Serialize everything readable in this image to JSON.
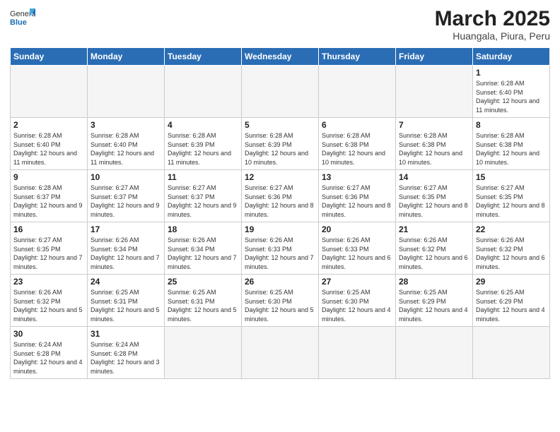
{
  "logo": {
    "text_general": "General",
    "text_blue": "Blue"
  },
  "title": "March 2025",
  "subtitle": "Huangala, Piura, Peru",
  "days_of_week": [
    "Sunday",
    "Monday",
    "Tuesday",
    "Wednesday",
    "Thursday",
    "Friday",
    "Saturday"
  ],
  "weeks": [
    [
      {
        "day": "",
        "info": ""
      },
      {
        "day": "",
        "info": ""
      },
      {
        "day": "",
        "info": ""
      },
      {
        "day": "",
        "info": ""
      },
      {
        "day": "",
        "info": ""
      },
      {
        "day": "",
        "info": ""
      },
      {
        "day": "1",
        "info": "Sunrise: 6:28 AM\nSunset: 6:40 PM\nDaylight: 12 hours and 11 minutes."
      }
    ],
    [
      {
        "day": "2",
        "info": "Sunrise: 6:28 AM\nSunset: 6:40 PM\nDaylight: 12 hours and 11 minutes."
      },
      {
        "day": "3",
        "info": "Sunrise: 6:28 AM\nSunset: 6:40 PM\nDaylight: 12 hours and 11 minutes."
      },
      {
        "day": "4",
        "info": "Sunrise: 6:28 AM\nSunset: 6:39 PM\nDaylight: 12 hours and 11 minutes."
      },
      {
        "day": "5",
        "info": "Sunrise: 6:28 AM\nSunset: 6:39 PM\nDaylight: 12 hours and 10 minutes."
      },
      {
        "day": "6",
        "info": "Sunrise: 6:28 AM\nSunset: 6:38 PM\nDaylight: 12 hours and 10 minutes."
      },
      {
        "day": "7",
        "info": "Sunrise: 6:28 AM\nSunset: 6:38 PM\nDaylight: 12 hours and 10 minutes."
      },
      {
        "day": "8",
        "info": "Sunrise: 6:28 AM\nSunset: 6:38 PM\nDaylight: 12 hours and 10 minutes."
      }
    ],
    [
      {
        "day": "9",
        "info": "Sunrise: 6:28 AM\nSunset: 6:37 PM\nDaylight: 12 hours and 9 minutes."
      },
      {
        "day": "10",
        "info": "Sunrise: 6:27 AM\nSunset: 6:37 PM\nDaylight: 12 hours and 9 minutes."
      },
      {
        "day": "11",
        "info": "Sunrise: 6:27 AM\nSunset: 6:37 PM\nDaylight: 12 hours and 9 minutes."
      },
      {
        "day": "12",
        "info": "Sunrise: 6:27 AM\nSunset: 6:36 PM\nDaylight: 12 hours and 8 minutes."
      },
      {
        "day": "13",
        "info": "Sunrise: 6:27 AM\nSunset: 6:36 PM\nDaylight: 12 hours and 8 minutes."
      },
      {
        "day": "14",
        "info": "Sunrise: 6:27 AM\nSunset: 6:35 PM\nDaylight: 12 hours and 8 minutes."
      },
      {
        "day": "15",
        "info": "Sunrise: 6:27 AM\nSunset: 6:35 PM\nDaylight: 12 hours and 8 minutes."
      }
    ],
    [
      {
        "day": "16",
        "info": "Sunrise: 6:27 AM\nSunset: 6:35 PM\nDaylight: 12 hours and 7 minutes."
      },
      {
        "day": "17",
        "info": "Sunrise: 6:26 AM\nSunset: 6:34 PM\nDaylight: 12 hours and 7 minutes."
      },
      {
        "day": "18",
        "info": "Sunrise: 6:26 AM\nSunset: 6:34 PM\nDaylight: 12 hours and 7 minutes."
      },
      {
        "day": "19",
        "info": "Sunrise: 6:26 AM\nSunset: 6:33 PM\nDaylight: 12 hours and 7 minutes."
      },
      {
        "day": "20",
        "info": "Sunrise: 6:26 AM\nSunset: 6:33 PM\nDaylight: 12 hours and 6 minutes."
      },
      {
        "day": "21",
        "info": "Sunrise: 6:26 AM\nSunset: 6:32 PM\nDaylight: 12 hours and 6 minutes."
      },
      {
        "day": "22",
        "info": "Sunrise: 6:26 AM\nSunset: 6:32 PM\nDaylight: 12 hours and 6 minutes."
      }
    ],
    [
      {
        "day": "23",
        "info": "Sunrise: 6:26 AM\nSunset: 6:32 PM\nDaylight: 12 hours and 5 minutes."
      },
      {
        "day": "24",
        "info": "Sunrise: 6:25 AM\nSunset: 6:31 PM\nDaylight: 12 hours and 5 minutes."
      },
      {
        "day": "25",
        "info": "Sunrise: 6:25 AM\nSunset: 6:31 PM\nDaylight: 12 hours and 5 minutes."
      },
      {
        "day": "26",
        "info": "Sunrise: 6:25 AM\nSunset: 6:30 PM\nDaylight: 12 hours and 5 minutes."
      },
      {
        "day": "27",
        "info": "Sunrise: 6:25 AM\nSunset: 6:30 PM\nDaylight: 12 hours and 4 minutes."
      },
      {
        "day": "28",
        "info": "Sunrise: 6:25 AM\nSunset: 6:29 PM\nDaylight: 12 hours and 4 minutes."
      },
      {
        "day": "29",
        "info": "Sunrise: 6:25 AM\nSunset: 6:29 PM\nDaylight: 12 hours and 4 minutes."
      }
    ],
    [
      {
        "day": "30",
        "info": "Sunrise: 6:24 AM\nSunset: 6:28 PM\nDaylight: 12 hours and 4 minutes."
      },
      {
        "day": "31",
        "info": "Sunrise: 6:24 AM\nSunset: 6:28 PM\nDaylight: 12 hours and 3 minutes."
      },
      {
        "day": "",
        "info": ""
      },
      {
        "day": "",
        "info": ""
      },
      {
        "day": "",
        "info": ""
      },
      {
        "day": "",
        "info": ""
      },
      {
        "day": "",
        "info": ""
      }
    ]
  ]
}
